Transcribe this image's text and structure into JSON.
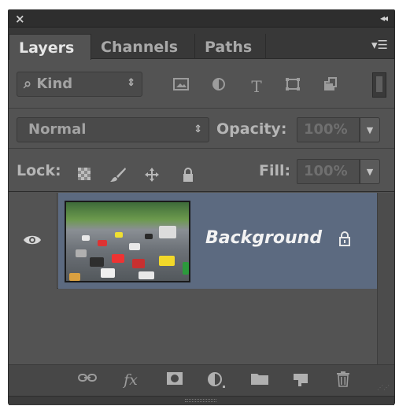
{
  "titlebar": {
    "close_glyph": "×",
    "collapse_glyph": "◂◂"
  },
  "tabs": [
    {
      "label": "Layers",
      "active": true
    },
    {
      "label": "Channels",
      "active": false
    },
    {
      "label": "Paths",
      "active": false
    }
  ],
  "filter": {
    "kind_label": "⌕ Kind",
    "icons": [
      "pixel-filter-icon",
      "adjustment-filter-icon",
      "type-filter-icon",
      "shape-filter-icon",
      "smart-object-filter-icon"
    ]
  },
  "blend": {
    "mode": "Normal",
    "opacity_label": "Opacity:",
    "opacity_value": "100%"
  },
  "lock": {
    "label": "Lock:",
    "icons": [
      "lock-transparent-pixels-icon",
      "lock-image-pixels-icon",
      "lock-position-icon",
      "lock-all-icon"
    ],
    "fill_label": "Fill:",
    "fill_value": "100%"
  },
  "layers": [
    {
      "name": "Background",
      "visible": true,
      "locked": true,
      "selected": true
    }
  ],
  "footer": {
    "icons": [
      "link-layers-icon",
      "fx-icon",
      "add-mask-icon",
      "new-adjustment-layer-icon",
      "new-group-icon",
      "new-layer-icon",
      "delete-layer-icon"
    ],
    "fx_text": "fx"
  },
  "colors": {
    "panel_bg": "#535353",
    "selected_row": "#5c6a80",
    "tab_bar": "#383838"
  }
}
